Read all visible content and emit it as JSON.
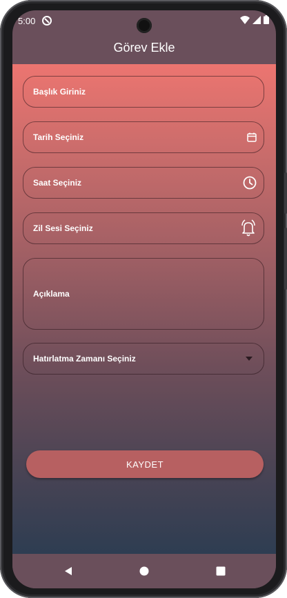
{
  "status_bar": {
    "time": "5:00",
    "icons": [
      "cast-icon",
      "wifi-icon",
      "signal-icon",
      "battery-icon"
    ]
  },
  "app_bar": {
    "title": "Görev Ekle"
  },
  "form": {
    "title_field": {
      "placeholder": "Başlık Giriniz"
    },
    "date_field": {
      "label": "Tarih Seçiniz",
      "icon": "calendar-icon"
    },
    "time_field": {
      "label": "Saat Seçiniz",
      "icon": "clock-icon"
    },
    "ringtone_field": {
      "label": "Zil Sesi Seçiniz",
      "icon": "bell-icon"
    },
    "description_field": {
      "placeholder": "Açıklama"
    },
    "reminder_dropdown": {
      "selected": "Hatırlatma Zamanı Seçiniz",
      "icon": "dropdown-arrow-icon"
    },
    "save_label": "KAYDET"
  },
  "nav_bar": {
    "buttons": [
      "back-icon",
      "home-icon",
      "recents-icon"
    ]
  },
  "colors": {
    "gradient_top": "#ec7570",
    "gradient_bottom": "#2e3d52",
    "bar_background": "#6a4f5b",
    "save_button": "#b76061"
  }
}
